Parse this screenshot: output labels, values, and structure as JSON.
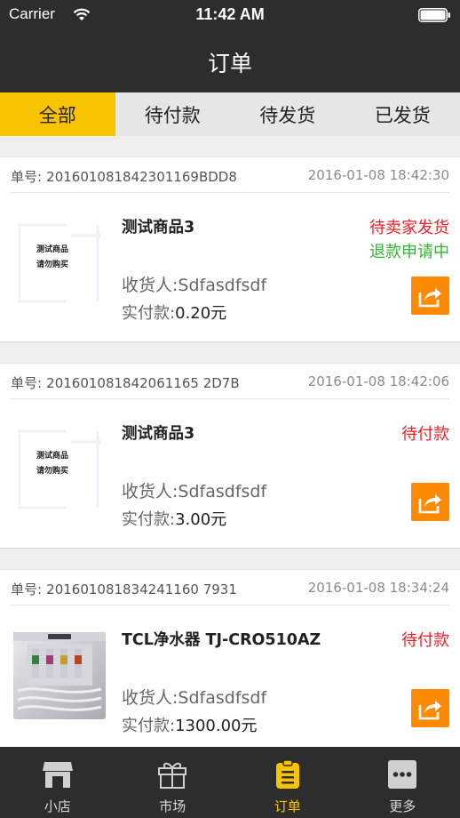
{
  "status_bar": {
    "carrier": "Carrier",
    "time": "11:42 AM"
  },
  "nav": {
    "title": "订单"
  },
  "tabs": [
    {
      "label": "全部",
      "active": true
    },
    {
      "label": "待付款",
      "active": false
    },
    {
      "label": "待发货",
      "active": false
    },
    {
      "label": "已发货",
      "active": false
    }
  ],
  "orders": [
    {
      "order_no_label": "单号:",
      "order_no": "201601081842301169BDD8",
      "time": "2016-01-08 18:42:30",
      "product_name": "测试商品3",
      "thumb_text": [
        "测试商品",
        "请勿购买"
      ],
      "status": "待卖家发货",
      "sub_status": "退款申请中",
      "receiver_label": "收货人:",
      "receiver": "Sdfasdfsdf",
      "paid_label": "实付款:",
      "paid_amount": "0.20元"
    },
    {
      "order_no_label": "单号:",
      "order_no": "201601081842061165 2D7B",
      "time": "2016-01-08 18:42:06",
      "product_name": "测试商品3",
      "thumb_text": [
        "测试商品",
        "请勿购买"
      ],
      "status": "待付款",
      "sub_status": "",
      "receiver_label": "收货人:",
      "receiver": "Sdfasdfsdf",
      "paid_label": "实付款:",
      "paid_amount": "3.00元"
    },
    {
      "order_no_label": "单号:",
      "order_no": "201601081834241160 7931",
      "time": "2016-01-08 18:34:24",
      "product_name": "TCL净水器 TJ-CRO510AZ",
      "thumb_text": [],
      "status": "待付款",
      "sub_status": "",
      "receiver_label": "收货人:",
      "receiver": "Sdfasdfsdf",
      "paid_label": "实付款:",
      "paid_amount": "1300.00元"
    }
  ],
  "tabbar": [
    {
      "label": "小店",
      "icon": "store-icon",
      "active": false
    },
    {
      "label": "市场",
      "icon": "gift-icon",
      "active": false
    },
    {
      "label": "订单",
      "icon": "clipboard-icon",
      "active": true
    },
    {
      "label": "更多",
      "icon": "more-icon",
      "active": false
    }
  ],
  "colors": {
    "accent": "#f8c400",
    "header_bg": "#2d2d2d",
    "status_red": "#e8222a",
    "status_green": "#32b632",
    "share_orange": "#ff8a00"
  }
}
